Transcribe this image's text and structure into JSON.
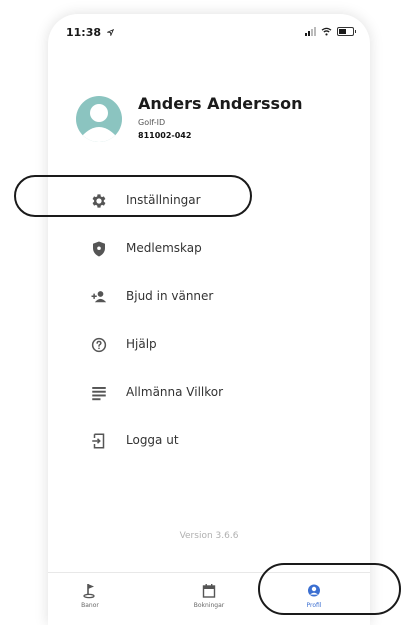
{
  "status_bar": {
    "time": "11:38",
    "location_icon": "location-arrow-icon"
  },
  "profile": {
    "name": "Anders Andersson",
    "golf_id_label": "Golf-ID",
    "golf_id": "811002-042"
  },
  "menu": {
    "items": [
      {
        "label": "Inställningar",
        "icon": "gear-icon"
      },
      {
        "label": "Medlemskap",
        "icon": "shield-icon"
      },
      {
        "label": "Bjud in vänner",
        "icon": "add-person-icon"
      },
      {
        "label": "Hjälp",
        "icon": "help-circle-icon"
      },
      {
        "label": "Allmänna Villkor",
        "icon": "document-lines-icon"
      },
      {
        "label": "Logga ut",
        "icon": "logout-icon"
      }
    ]
  },
  "version": "Version 3.6.6",
  "tabbar": {
    "tabs": [
      {
        "label": "Banor",
        "icon": "golf-flag-icon",
        "active": false
      },
      {
        "label": "Bokningar",
        "icon": "calendar-icon",
        "active": false
      },
      {
        "label": "Profil",
        "icon": "user-circle-icon",
        "active": true
      }
    ]
  },
  "colors": {
    "accent": "#3b6fd1",
    "avatar": "#8bc4c0",
    "text": "#333333",
    "muted": "#b0b0b0"
  }
}
